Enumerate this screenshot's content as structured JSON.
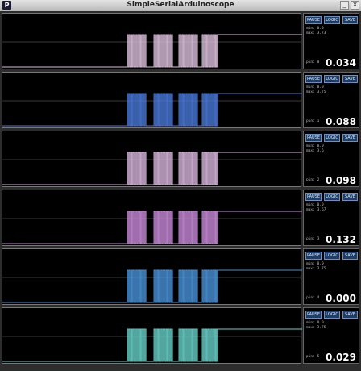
{
  "window": {
    "title": "SimpleSerialArduinoscope",
    "icon_letter": "P",
    "minimize_glyph": "_",
    "close_glyph": "x"
  },
  "buttons": {
    "pause": "PAUSE",
    "logic": "LOGIC",
    "save": "SAVE"
  },
  "stat_labels": {
    "min": "min:",
    "max": "max:",
    "pin": "pin:"
  },
  "channels": [
    {
      "pin": "0",
      "min": "0.0",
      "max": "3.73",
      "value": "0.034",
      "color": "#dcc0dc"
    },
    {
      "pin": "1",
      "min": "0.0",
      "max": "3.75",
      "value": "0.088",
      "color": "#4a78d8"
    },
    {
      "pin": "2",
      "min": "0.0",
      "max": "3.6",
      "value": "0.098",
      "color": "#d7b6dc"
    },
    {
      "pin": "3",
      "min": "0.0",
      "max": "3.67",
      "value": "0.132",
      "color": "#c98ad8"
    },
    {
      "pin": "4",
      "min": "0.0",
      "max": "3.75",
      "value": "0.000",
      "color": "#4a92d8"
    },
    {
      "pin": "5",
      "min": "0.0",
      "max": "3.75",
      "value": "0.029",
      "color": "#68d0c8"
    }
  ]
}
